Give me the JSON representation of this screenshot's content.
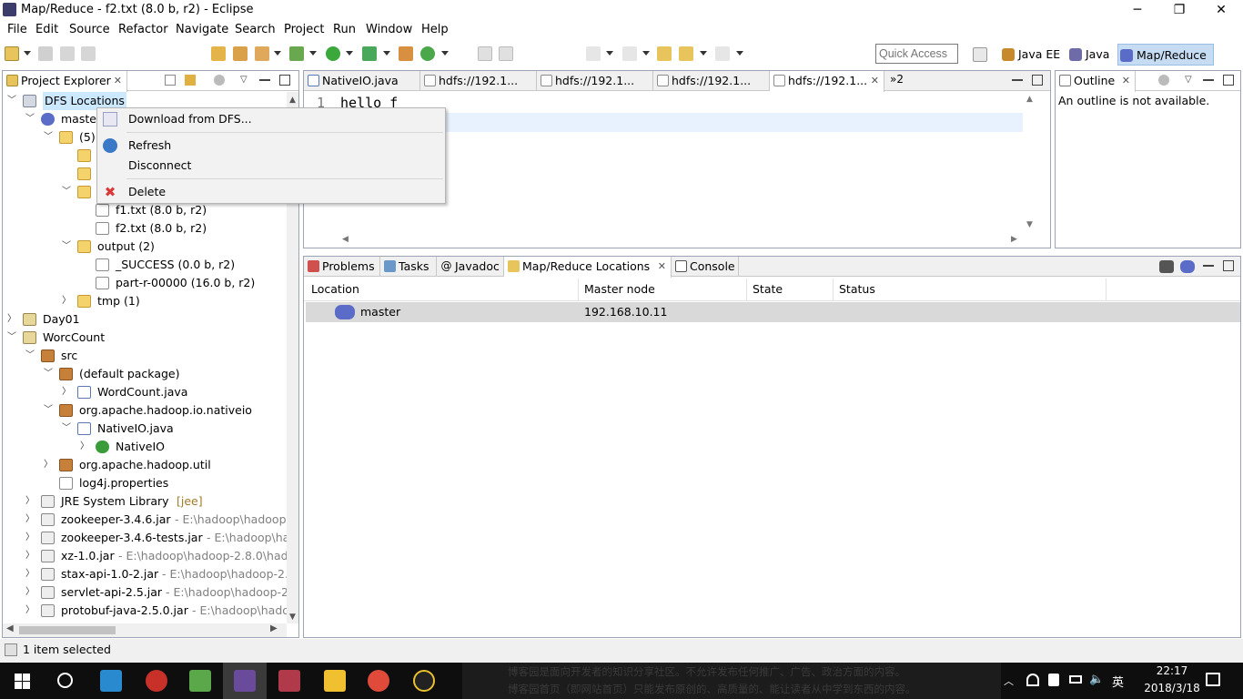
{
  "window": {
    "title": "Map/Reduce - f2.txt (8.0 b, r2) - Eclipse",
    "minimize": "─",
    "restore": "❐",
    "close": "✕"
  },
  "menu": [
    "File",
    "Edit",
    "Source",
    "Refactor",
    "Navigate",
    "Search",
    "Project",
    "Run",
    "Window",
    "Help"
  ],
  "quick_access": {
    "placeholder": "Quick Access"
  },
  "perspectives": [
    {
      "label": "Java EE",
      "color": "#c68a2c"
    },
    {
      "label": "Java",
      "color": "#6f6aa8"
    },
    {
      "label": "Map/Reduce",
      "color": "#5b6bc8",
      "active": true
    }
  ],
  "project_explorer": {
    "title": "Project Explorer",
    "rows": [
      {
        "indent": 0,
        "arrow": "down",
        "icon": "dfs",
        "label": "DFS Locations"
      },
      {
        "indent": 1,
        "arrow": "down",
        "icon": "elephant",
        "label": "master"
      },
      {
        "indent": 2,
        "arrow": "down",
        "icon": "folder",
        "label": "(5)"
      },
      {
        "indent": 3,
        "arrow": "",
        "icon": "folder",
        "label": ""
      },
      {
        "indent": 3,
        "arrow": "",
        "icon": "folder",
        "label": ""
      },
      {
        "indent": 3,
        "arrow": "down",
        "icon": "folder",
        "label": ""
      },
      {
        "indent": 4,
        "arrow": "",
        "icon": "file",
        "label": "f1.txt (8.0 b, r2)"
      },
      {
        "indent": 4,
        "arrow": "",
        "icon": "file",
        "label": "f2.txt (8.0 b, r2)"
      },
      {
        "indent": 3,
        "arrow": "down",
        "icon": "folder",
        "label": "output (2)"
      },
      {
        "indent": 4,
        "arrow": "",
        "icon": "file",
        "label": "_SUCCESS (0.0 b, r2)"
      },
      {
        "indent": 4,
        "arrow": "",
        "icon": "file",
        "label": "part-r-00000 (16.0 b, r2)"
      },
      {
        "indent": 3,
        "arrow": "right",
        "icon": "folder",
        "label": "tmp (1)"
      },
      {
        "indent": 0,
        "arrow": "right",
        "icon": "proj",
        "label": "Day01"
      },
      {
        "indent": 0,
        "arrow": "down",
        "icon": "proj",
        "label": "WorcCount"
      },
      {
        "indent": 1,
        "arrow": "down",
        "icon": "pkg",
        "label": "src"
      },
      {
        "indent": 2,
        "arrow": "down",
        "icon": "pkg",
        "label": "(default package)"
      },
      {
        "indent": 3,
        "arrow": "right",
        "icon": "java",
        "label": "WordCount.java"
      },
      {
        "indent": 2,
        "arrow": "down",
        "icon": "pkg",
        "label": "org.apache.hadoop.io.nativeio"
      },
      {
        "indent": 3,
        "arrow": "down",
        "icon": "java",
        "label": "NativeIO.java"
      },
      {
        "indent": 4,
        "arrow": "right",
        "icon": "cls",
        "label": "NativeIO"
      },
      {
        "indent": 2,
        "arrow": "right",
        "icon": "pkg",
        "label": "org.apache.hadoop.util"
      },
      {
        "indent": 2,
        "arrow": "",
        "icon": "file",
        "label": "log4j.properties"
      },
      {
        "indent": 1,
        "arrow": "right",
        "icon": "jar",
        "label": "JRE System Library",
        "deco": "[jee]"
      },
      {
        "indent": 1,
        "arrow": "right",
        "icon": "jar",
        "label": "zookeeper-3.4.6.jar",
        "dim": "- E:\\hadoop\\hadoop-"
      },
      {
        "indent": 1,
        "arrow": "right",
        "icon": "jar",
        "label": "zookeeper-3.4.6-tests.jar",
        "dim": "- E:\\hadoop\\ha"
      },
      {
        "indent": 1,
        "arrow": "right",
        "icon": "jar",
        "label": "xz-1.0.jar",
        "dim": "- E:\\hadoop\\hadoop-2.8.0\\hado"
      },
      {
        "indent": 1,
        "arrow": "right",
        "icon": "jar",
        "label": "stax-api-1.0-2.jar",
        "dim": "- E:\\hadoop\\hadoop-2.8"
      },
      {
        "indent": 1,
        "arrow": "right",
        "icon": "jar",
        "label": "servlet-api-2.5.jar",
        "dim": "- E:\\hadoop\\hadoop-2."
      },
      {
        "indent": 1,
        "arrow": "right",
        "icon": "jar",
        "label": "protobuf-java-2.5.0.jar",
        "dim": "- E:\\hadoop\\hado"
      }
    ]
  },
  "context_menu": {
    "items": [
      {
        "label": "Download from DFS...",
        "icon": "download-icon"
      },
      {
        "label": "Refresh",
        "icon": "refresh-icon"
      },
      {
        "label": "Disconnect",
        "icon": ""
      },
      {
        "label": "Delete",
        "icon": "delete-icon"
      }
    ]
  },
  "editor": {
    "tabs": [
      "NativeIO.java",
      "hdfs://192.1...",
      "hdfs://192.1...",
      "hdfs://192.1...",
      "hdfs://192.1..."
    ],
    "overflow": "»2",
    "line_number": "1",
    "content": "hello f"
  },
  "outline": {
    "title": "Outline",
    "message": "An outline is not available."
  },
  "bottom": {
    "tabs": [
      "Problems",
      "Tasks",
      "Javadoc",
      "Map/Reduce Locations",
      "Console"
    ],
    "columns": [
      "Location",
      "Master node",
      "State",
      "Status"
    ],
    "rows": [
      {
        "location": "master",
        "master_node": "192.168.10.11",
        "state": "",
        "status": ""
      }
    ]
  },
  "status": {
    "text": "1 item selected"
  },
  "taskbar": {
    "watermark_line1": "博客园是面向开发者的知识分享社区。不允许发布任何推广、广告、政治方面的内容。",
    "watermark_line2": "博客园首页（即网站首页）只能发布原创的、高质量的、能让读者从中学到东西的内容。",
    "ime": "英",
    "time": "22:17",
    "date": "2018/3/18"
  }
}
